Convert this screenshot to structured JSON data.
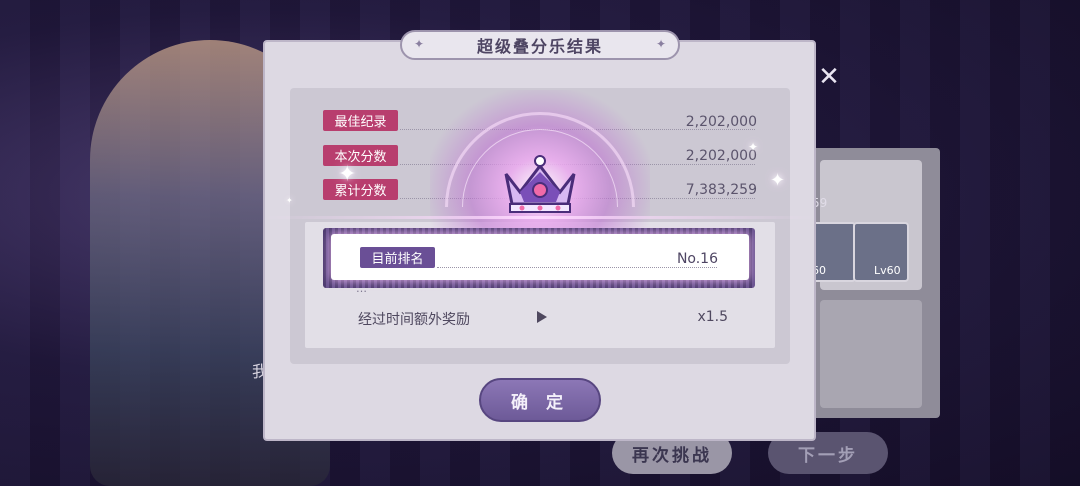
{
  "dialog": {
    "title": "超级叠分乐结果",
    "stats": [
      {
        "label": "最佳纪录",
        "value": "2,202,000"
      },
      {
        "label": "本次分数",
        "value": "2,202,000"
      },
      {
        "label": "累计分数",
        "value": "7,383,259"
      }
    ],
    "rank": {
      "label": "目前排名",
      "value": "No.16"
    },
    "hidden_row_text": "…",
    "bonus": {
      "label": "经过时间额外奖励",
      "value": "x1.5"
    },
    "confirm_label": "确 定"
  },
  "background": {
    "retry_label": "再次挑战",
    "next_label": "下一步",
    "close_glyph": "✕",
    "partial_text": "我",
    "level_left": "60",
    "level_right": "Lv60",
    "score_partial": "59"
  },
  "colors": {
    "stat_label_bg": "#b83e6e",
    "rank_label_bg": "#6a4f96",
    "confirm_bg": "#7b68a8"
  },
  "icons": [
    "crown-icon",
    "play-icon",
    "sparkle-icon",
    "close-icon"
  ]
}
